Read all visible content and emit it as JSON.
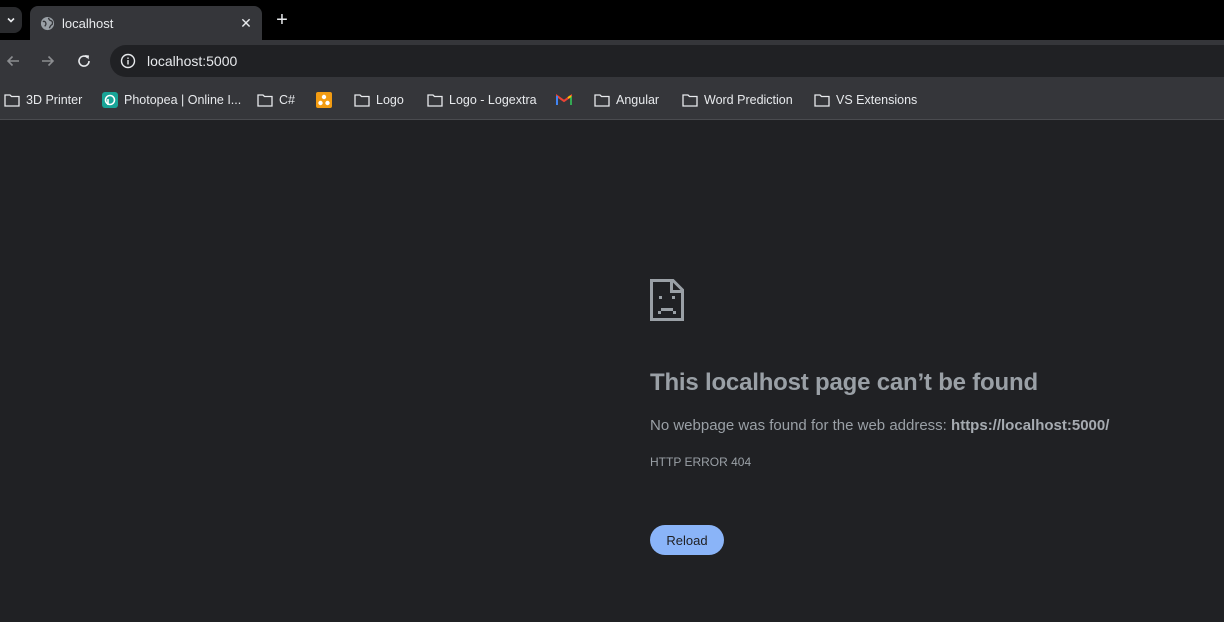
{
  "tab": {
    "title": "localhost",
    "close_glyph": "✕",
    "new_tab_glyph": "+"
  },
  "toolbar": {
    "url": "localhost:5000"
  },
  "bookmarks": [
    {
      "label": "3D Printer",
      "icon": "folder-icon"
    },
    {
      "label": "Photopea | Online I...",
      "icon": "photopea-icon"
    },
    {
      "label": "C#",
      "icon": "folder-icon"
    },
    {
      "label": "",
      "icon": "orange-app-icon"
    },
    {
      "label": "Logo",
      "icon": "folder-icon"
    },
    {
      "label": "Logo - Logextra",
      "icon": "folder-icon"
    },
    {
      "label": "",
      "icon": "gmail-icon"
    },
    {
      "label": "Angular",
      "icon": "folder-icon"
    },
    {
      "label": "Word Prediction",
      "icon": "folder-icon"
    },
    {
      "label": "VS Extensions",
      "icon": "folder-icon"
    }
  ],
  "error": {
    "title": "This localhost page can’t be found",
    "description_prefix": "No webpage was found for the web address: ",
    "description_url": "https://localhost:5000/",
    "code": "HTTP ERROR 404",
    "reload_label": "Reload"
  },
  "colors": {
    "accent": "#8ab4f8",
    "background": "#202124",
    "toolbar": "#35363a"
  }
}
